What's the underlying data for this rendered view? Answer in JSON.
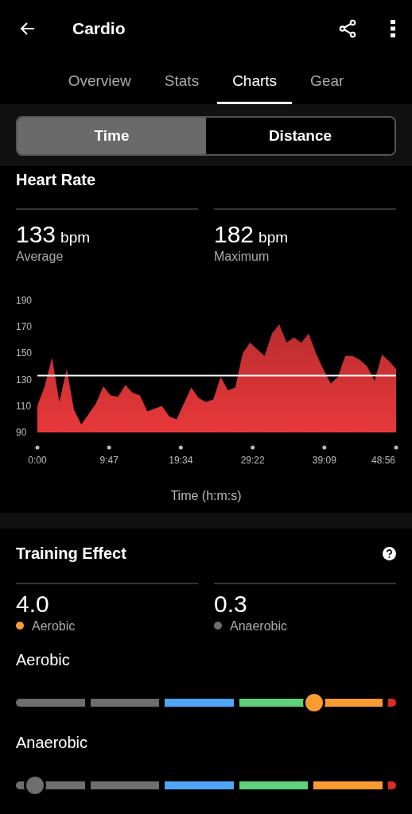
{
  "header": {
    "title": "Cardio"
  },
  "tabs": [
    {
      "label": "Overview",
      "selected": false
    },
    {
      "label": "Stats",
      "selected": false
    },
    {
      "label": "Charts",
      "selected": true
    },
    {
      "label": "Gear",
      "selected": false
    }
  ],
  "segments": [
    {
      "label": "Time",
      "selected": true
    },
    {
      "label": "Distance",
      "selected": false
    }
  ],
  "heart_rate": {
    "title": "Heart Rate",
    "stats": [
      {
        "value": "133",
        "unit": "bpm",
        "label": "Average"
      },
      {
        "value": "182",
        "unit": "bpm",
        "label": "Maximum"
      }
    ],
    "chart_data": {
      "type": "area",
      "xlabel": "Time (h:m:s)",
      "x": [
        0,
        60,
        120,
        180,
        240,
        300,
        360,
        420,
        480,
        540,
        600,
        660,
        720,
        780,
        840,
        900,
        960,
        1020,
        1080,
        1140,
        1200,
        1260,
        1320,
        1380,
        1440,
        1500,
        1560,
        1620,
        1680,
        1740,
        1800,
        1860,
        1920,
        1980,
        2040,
        2100,
        2160,
        2220,
        2280,
        2340,
        2400,
        2460,
        2520,
        2580,
        2640,
        2700,
        2760,
        2820,
        2880,
        2936
      ],
      "series": [
        {
          "color": "#e8383a",
          "values": [
            110,
            125,
            147,
            113,
            138,
            107,
            96,
            104,
            112,
            125,
            118,
            117,
            126,
            120,
            118,
            106,
            108,
            110,
            102,
            100,
            112,
            124,
            116,
            113,
            115,
            132,
            122,
            124,
            150,
            158,
            153,
            148,
            165,
            172,
            158,
            162,
            158,
            165,
            150,
            138,
            127,
            132,
            148,
            148,
            145,
            140,
            129,
            149,
            144,
            138
          ]
        }
      ],
      "xlim": [
        0,
        2936
      ],
      "ylim": [
        90,
        190
      ],
      "xticks": [
        {
          "value": 0,
          "label": "0:00"
        },
        {
          "value": 587,
          "label": "9:47"
        },
        {
          "value": 1174,
          "label": "19:34"
        },
        {
          "value": 1762,
          "label": "29:22"
        },
        {
          "value": 2349,
          "label": "39:09"
        },
        {
          "value": 2936,
          "label": "48:56"
        }
      ],
      "yticks": [
        90,
        110,
        130,
        150,
        170,
        190
      ],
      "ref_lines": [
        {
          "axis": "y",
          "value": 133
        }
      ]
    }
  },
  "training_effect": {
    "title": "Training Effect",
    "stats": [
      {
        "value": "4.0",
        "label": "Aerobic",
        "color": "#fa9b32"
      },
      {
        "value": "0.3",
        "label": "Anaerobic",
        "color": "#6e6e6e"
      }
    ],
    "scales": [
      {
        "label": "Aerobic",
        "level": 0.785
      },
      {
        "label": "Anaerobic",
        "level": 0.05
      }
    ]
  }
}
